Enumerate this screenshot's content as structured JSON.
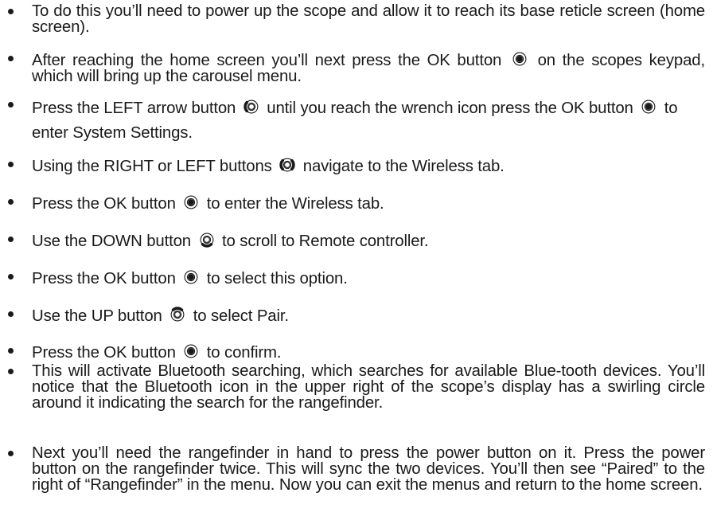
{
  "steps": [
    {
      "parts": [
        "To do this you’ll need to power up the scope and allow it to reach its base reticle screen (home screen)."
      ]
    },
    {
      "parts": [
        "After reaching the home screen you’ll next press the OK button",
        "on the scopes keypad, which will bring up the carousel menu."
      ],
      "icons": [
        "keypad-ok-icon"
      ]
    },
    {
      "parts": [
        "Press the LEFT arrow button",
        "until you reach the wrench icon press the OK button",
        "to enter System Settings."
      ],
      "icons": [
        "keypad-left-icon",
        "keypad-ok-icon"
      ]
    },
    {
      "parts": [
        "Using the RIGHT or LEFT buttons",
        "navigate to the Wireless tab."
      ],
      "icons": [
        "keypad-left-right-icon"
      ]
    },
    {
      "parts": [
        "Press the OK button",
        "to enter the Wireless tab."
      ],
      "icons": [
        "keypad-ok-icon"
      ]
    },
    {
      "parts": [
        "Use the DOWN button",
        "to scroll to Remote controller."
      ],
      "icons": [
        "keypad-down-icon"
      ]
    },
    {
      "parts": [
        "Press the OK button",
        "to select this option."
      ],
      "icons": [
        "keypad-ok-icon"
      ]
    },
    {
      "parts": [
        "Use the UP button",
        "to select Pair."
      ],
      "icons": [
        "keypad-up-icon"
      ]
    },
    {
      "parts": [
        "Press the OK button",
        "to confirm."
      ],
      "icons": [
        "keypad-ok-icon"
      ]
    },
    {
      "parts": [
        "This will activate Bluetooth searching, which searches for available Blue-tooth devices. You’ll notice that the Bluetooth icon in the upper right of the scope’s display has a swirling circle around it indicating the search for the rangefinder."
      ]
    },
    {
      "parts": [
        "Next you’ll need the rangefinder in hand to press the power button on it. Press the power button on the rangefinder twice. This will sync the two devices. You’ll then see “Paired” to the right of “Rangefinder” in the menu. Now you can exit the menus and return to the home screen."
      ]
    }
  ]
}
